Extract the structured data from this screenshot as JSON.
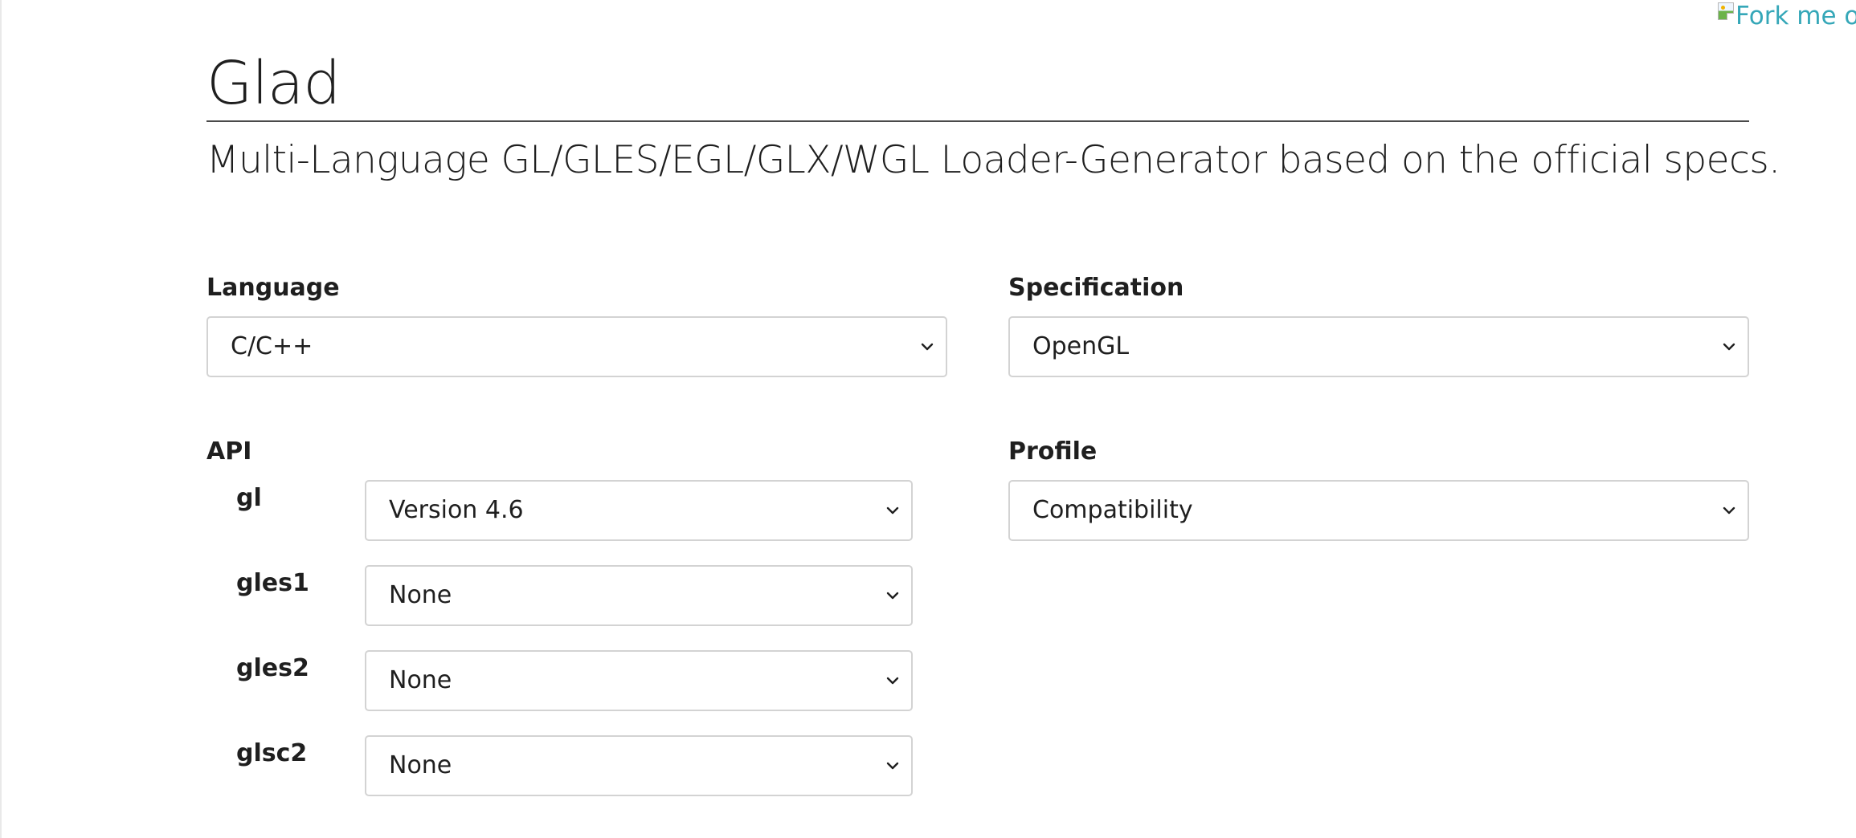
{
  "fork_link": {
    "alt_text": "Fork me on GitHub"
  },
  "header": {
    "title": "Glad",
    "subtitle": "Multi-Language GL/GLES/EGL/GLX/WGL Loader-Generator based on the official specs."
  },
  "form": {
    "language": {
      "label": "Language",
      "value": "C/C++"
    },
    "specification": {
      "label": "Specification",
      "value": "OpenGL"
    },
    "api": {
      "label": "API",
      "rows": [
        {
          "name": "gl",
          "value": "Version 4.6"
        },
        {
          "name": "gles1",
          "value": "None"
        },
        {
          "name": "gles2",
          "value": "None"
        },
        {
          "name": "glsc2",
          "value": "None"
        }
      ]
    },
    "profile": {
      "label": "Profile",
      "value": "Compatibility"
    }
  },
  "colors": {
    "link": "#35a7b8",
    "text": "#1f1f1f",
    "border": "#d3d3d3",
    "rule": "#4a4a4a"
  },
  "icons": {
    "select_arrow": "chevron-down-icon",
    "broken_image": "broken-image-icon"
  }
}
